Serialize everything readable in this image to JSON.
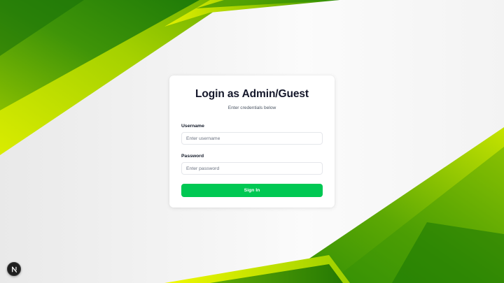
{
  "login": {
    "title": "Login as Admin/Guest",
    "subtitle": "Enter credentials below",
    "username_label": "Username",
    "username_placeholder": "Enter username",
    "username_value": "",
    "password_label": "Password",
    "password_placeholder": "Enter password",
    "password_value": "",
    "submit_label": "Sign In"
  },
  "dev_badge": {
    "icon": "nextjs-logo-icon"
  },
  "colors": {
    "accent": "#00c853",
    "title_text": "#14172a",
    "background_shape_dark": "#1d7a08",
    "background_shape_light": "#c6e400"
  }
}
